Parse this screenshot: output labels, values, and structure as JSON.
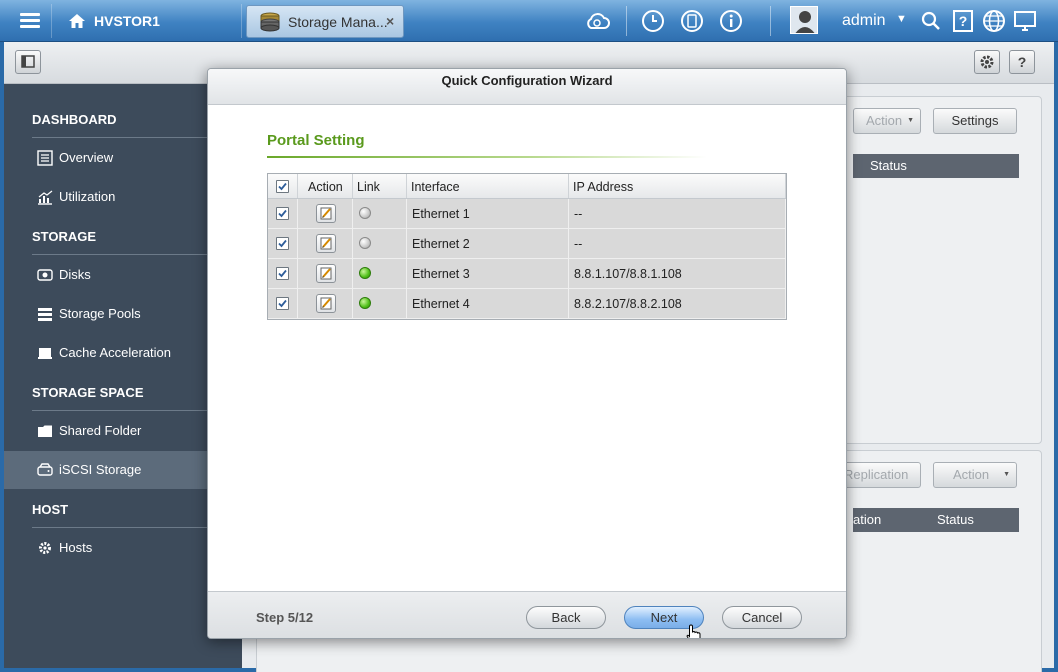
{
  "topbar": {
    "home_label": "HVSTOR1",
    "app_tab_label": "Storage Mana...",
    "app_tab_close": "×",
    "user_name": "admin",
    "icons": [
      "menu-icon",
      "home-icon",
      "storage-manager-icon",
      "cloud-sync-icon",
      "clock-icon",
      "sync-icon",
      "info-icon",
      "user-avatar-icon",
      "search-icon",
      "help-icon",
      "globe-icon",
      "monitor-icon"
    ]
  },
  "sidebar": {
    "sections": [
      {
        "label": "DASHBOARD",
        "items": [
          {
            "label": "Overview",
            "icon": "list-icon"
          },
          {
            "label": "Utilization",
            "icon": "chart-icon"
          }
        ]
      },
      {
        "label": "STORAGE",
        "items": [
          {
            "label": "Disks",
            "icon": "disk-icon"
          },
          {
            "label": "Storage Pools",
            "icon": "pools-icon"
          },
          {
            "label": "Cache Acceleration",
            "icon": "cache-icon"
          }
        ]
      },
      {
        "label": "STORAGE SPACE",
        "items": [
          {
            "label": "Shared Folder",
            "icon": "folder-icon"
          },
          {
            "label": "iSCSI Storage",
            "icon": "iscsi-icon",
            "active": true
          }
        ]
      },
      {
        "label": "HOST",
        "items": [
          {
            "label": "Hosts",
            "icon": "gear-icon"
          }
        ]
      }
    ]
  },
  "background_panels": {
    "top_action": "Action",
    "top_settings": "Settings",
    "top_status_header": "Status",
    "bottom_replication": "Replication",
    "bottom_action": "Action",
    "bottom_col_ation": "ation",
    "bottom_status_header": "Status"
  },
  "wizard": {
    "title": "Quick Configuration Wizard",
    "section_title": "Portal Setting",
    "columns": [
      "Action",
      "Link",
      "Interface",
      "IP Address"
    ],
    "rows": [
      {
        "checked": true,
        "link": "off",
        "interface": "Ethernet 1",
        "ip": "--"
      },
      {
        "checked": true,
        "link": "off",
        "interface": "Ethernet 2",
        "ip": "--"
      },
      {
        "checked": true,
        "link": "on",
        "interface": "Ethernet 3",
        "ip": "8.8.1.107/8.8.1.108"
      },
      {
        "checked": true,
        "link": "on",
        "interface": "Ethernet 4",
        "ip": "8.8.2.107/8.8.2.108"
      }
    ],
    "step": "Step 5/12",
    "back": "Back",
    "next": "Next",
    "cancel": "Cancel"
  },
  "colors": {
    "accent_green": "#5a9a1d",
    "link_on": "#4fbf18",
    "link_off": "#c9c9c9",
    "topbar_blue": "#3f82c2",
    "sidebar_bg": "#3d4b5b"
  }
}
